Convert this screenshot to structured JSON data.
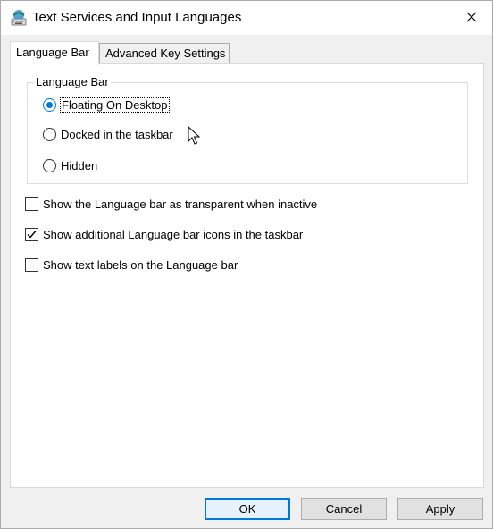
{
  "window": {
    "title": "Text Services and Input Languages",
    "app_icon": "keyboard-globe-icon",
    "close_icon": "close-icon"
  },
  "tabs": [
    {
      "label": "Language Bar",
      "active": true
    },
    {
      "label": "Advanced Key Settings",
      "active": false
    }
  ],
  "group": {
    "title": "Language Bar",
    "options": [
      {
        "label": "Floating On Desktop",
        "selected": true
      },
      {
        "label": "Docked in the taskbar",
        "selected": false
      },
      {
        "label": "Hidden",
        "selected": false
      }
    ]
  },
  "checkboxes": [
    {
      "label": "Show the Language bar as transparent when inactive",
      "checked": false
    },
    {
      "label": "Show additional Language bar icons in the taskbar",
      "checked": true
    },
    {
      "label": "Show text labels on the Language bar",
      "checked": false
    }
  ],
  "buttons": {
    "ok": "OK",
    "cancel": "Cancel",
    "apply": "Apply"
  },
  "colors": {
    "accent": "#0078d7",
    "panel": "#ffffff",
    "window_bg": "#f0f0f0"
  }
}
